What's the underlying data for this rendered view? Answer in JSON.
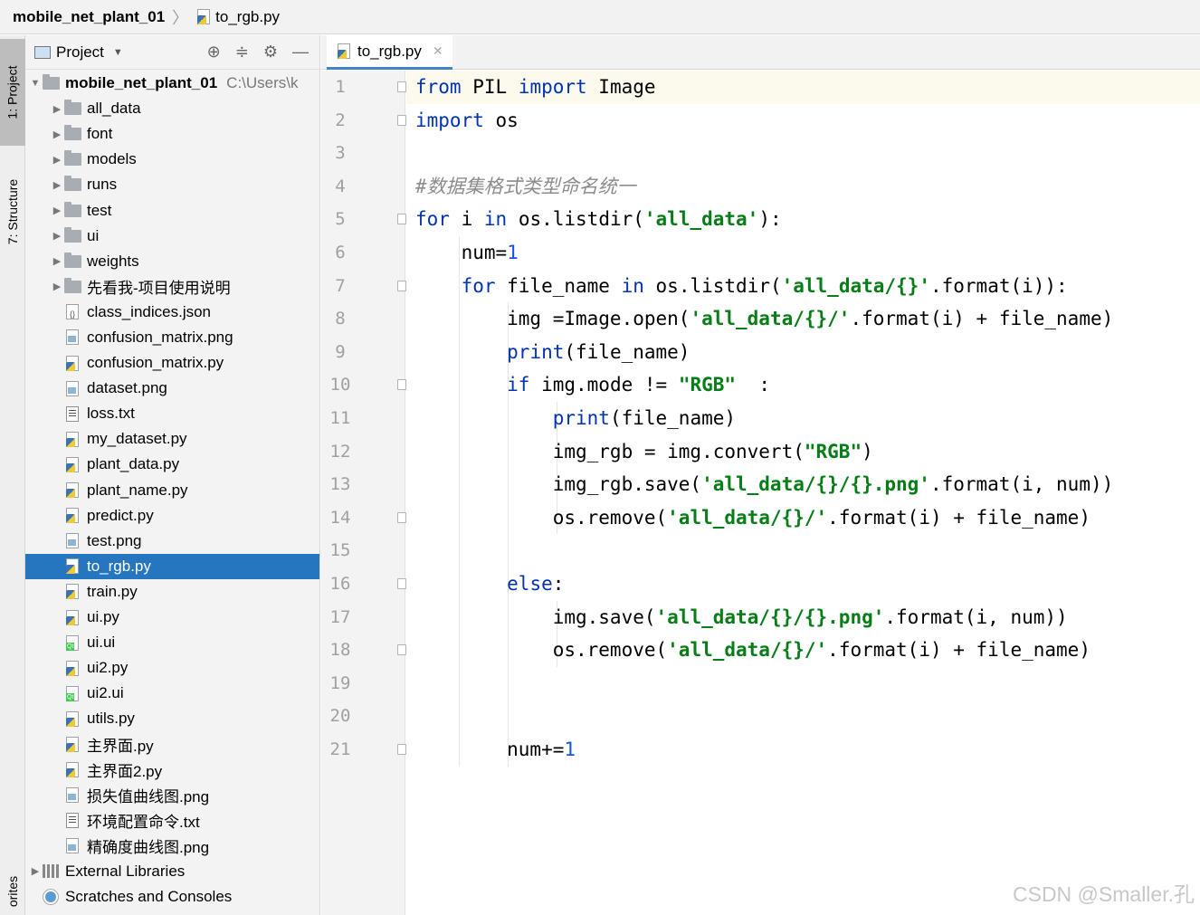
{
  "breadcrumb": {
    "project": "mobile_net_plant_01",
    "file": "to_rgb.py"
  },
  "side_strip": {
    "project_tab": "1: Project",
    "structure_tab": "7: Structure",
    "favorites_tab": "orites"
  },
  "project_panel": {
    "title": "Project",
    "root": {
      "name": "mobile_net_plant_01",
      "path": "C:\\Users\\k"
    },
    "items": [
      {
        "label": "all_data",
        "kind": "folder"
      },
      {
        "label": "font",
        "kind": "folder"
      },
      {
        "label": "models",
        "kind": "folder"
      },
      {
        "label": "runs",
        "kind": "folder"
      },
      {
        "label": "test",
        "kind": "folder"
      },
      {
        "label": "ui",
        "kind": "folder"
      },
      {
        "label": "weights",
        "kind": "folder"
      },
      {
        "label": "先看我-项目使用说明",
        "kind": "folder"
      },
      {
        "label": "class_indices.json",
        "kind": "json"
      },
      {
        "label": "confusion_matrix.png",
        "kind": "image"
      },
      {
        "label": "confusion_matrix.py",
        "kind": "python"
      },
      {
        "label": "dataset.png",
        "kind": "image"
      },
      {
        "label": "loss.txt",
        "kind": "text"
      },
      {
        "label": "my_dataset.py",
        "kind": "python"
      },
      {
        "label": "plant_data.py",
        "kind": "python"
      },
      {
        "label": "plant_name.py",
        "kind": "python"
      },
      {
        "label": "predict.py",
        "kind": "python"
      },
      {
        "label": "test.png",
        "kind": "image"
      },
      {
        "label": "to_rgb.py",
        "kind": "python",
        "selected": true
      },
      {
        "label": "train.py",
        "kind": "python"
      },
      {
        "label": "ui.py",
        "kind": "python"
      },
      {
        "label": "ui.ui",
        "kind": "qt"
      },
      {
        "label": "ui2.py",
        "kind": "python"
      },
      {
        "label": "ui2.ui",
        "kind": "qt"
      },
      {
        "label": "utils.py",
        "kind": "python"
      },
      {
        "label": "主界面.py",
        "kind": "python"
      },
      {
        "label": "主界面2.py",
        "kind": "python"
      },
      {
        "label": "损失值曲线图.png",
        "kind": "image"
      },
      {
        "label": "环境配置命令.txt",
        "kind": "text"
      },
      {
        "label": "精确度曲线图.png",
        "kind": "image"
      }
    ],
    "external_libraries": "External Libraries",
    "scratches": "Scratches and Consoles"
  },
  "editor": {
    "tab_label": "to_rgb.py",
    "line_numbers": [
      "1",
      "2",
      "3",
      "4",
      "5",
      "6",
      "7",
      "8",
      "9",
      "10",
      "11",
      "12",
      "13",
      "14",
      "15",
      "16",
      "17",
      "18",
      "19",
      "20",
      "21"
    ],
    "lines": [
      [
        [
          "kw",
          "from"
        ],
        [
          "t",
          " PIL "
        ],
        [
          "kw",
          "import"
        ],
        [
          "t",
          " Image"
        ]
      ],
      [
        [
          "kw",
          "import"
        ],
        [
          "t",
          " os"
        ]
      ],
      [],
      [
        [
          "cm",
          "#数据集格式类型命名统一"
        ]
      ],
      [
        [
          "kw",
          "for"
        ],
        [
          "t",
          " i "
        ],
        [
          "kw",
          "in"
        ],
        [
          "t",
          " os.listdir("
        ],
        [
          "str",
          "'all_data'"
        ],
        [
          "t",
          "):"
        ]
      ],
      [
        [
          "t",
          "    num="
        ],
        [
          "num",
          "1"
        ]
      ],
      [
        [
          "t",
          "    "
        ],
        [
          "kw",
          "for"
        ],
        [
          "t",
          " file_name "
        ],
        [
          "kw",
          "in"
        ],
        [
          "t",
          " os.listdir("
        ],
        [
          "str",
          "'all_data/{}'"
        ],
        [
          "t",
          ".format(i)):"
        ]
      ],
      [
        [
          "t",
          "        img =Image.open("
        ],
        [
          "str",
          "'all_data/{}/'"
        ],
        [
          "t",
          ".format(i) + file_name)"
        ]
      ],
      [
        [
          "t",
          "        "
        ],
        [
          "kw",
          "print"
        ],
        [
          "t",
          "(file_name)"
        ]
      ],
      [
        [
          "t",
          "        "
        ],
        [
          "kw",
          "if"
        ],
        [
          "t",
          " img.mode != "
        ],
        [
          "str",
          "\"RGB\""
        ],
        [
          "t",
          "  :"
        ]
      ],
      [
        [
          "t",
          "            "
        ],
        [
          "kw",
          "print"
        ],
        [
          "t",
          "(file_name)"
        ]
      ],
      [
        [
          "t",
          "            img_rgb = img.convert("
        ],
        [
          "str",
          "\"RGB\""
        ],
        [
          "t",
          ")"
        ]
      ],
      [
        [
          "t",
          "            img_rgb.save("
        ],
        [
          "str",
          "'all_data/{}/{}.png'"
        ],
        [
          "t",
          ".format(i, num))"
        ]
      ],
      [
        [
          "t",
          "            os.remove("
        ],
        [
          "str",
          "'all_data/{}/'"
        ],
        [
          "t",
          ".format(i) + file_name)"
        ]
      ],
      [],
      [
        [
          "t",
          "        "
        ],
        [
          "kw",
          "else"
        ],
        [
          "t",
          ":"
        ]
      ],
      [
        [
          "t",
          "            img.save("
        ],
        [
          "str",
          "'all_data/{}/{}.png'"
        ],
        [
          "t",
          ".format(i, num))"
        ]
      ],
      [
        [
          "t",
          "            os.remove("
        ],
        [
          "str",
          "'all_data/{}/'"
        ],
        [
          "t",
          ".format(i) + file_name)"
        ]
      ],
      [],
      [],
      [
        [
          "t",
          "        num+="
        ],
        [
          "num",
          "1"
        ]
      ]
    ]
  },
  "watermark": "CSDN @Smaller.孔"
}
